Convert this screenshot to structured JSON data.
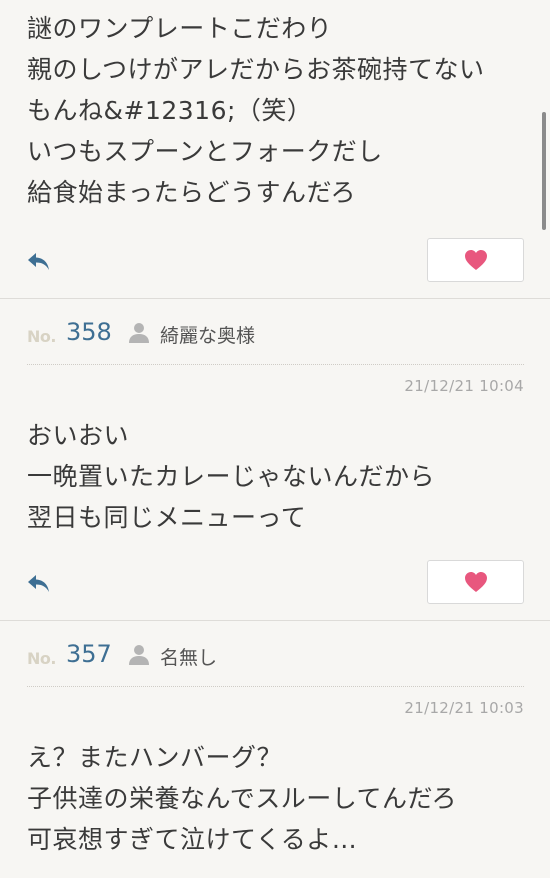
{
  "posts": [
    {
      "lines": [
        "謎のワンプレートこだわり",
        "親のしつけがアレだからお茶碗持てない",
        "もんね&#12316;（笑）",
        "いつもスプーンとフォークだし",
        "給食始まったらどうすんだろ"
      ]
    },
    {
      "no_label": "No.",
      "number": "358",
      "user": "綺麗な奥様",
      "timestamp": "21/12/21 10:04",
      "lines": [
        "おいおい",
        "一晩置いたカレーじゃないんだから",
        "翌日も同じメニューって"
      ]
    },
    {
      "no_label": "No.",
      "number": "357",
      "user": "名無し",
      "timestamp": "21/12/21 10:03",
      "lines": [
        "え？またハンバーグ？",
        "子供達の栄養なんでスルーしてんだろ",
        "可哀想すぎて泣けてくるよ…"
      ]
    }
  ],
  "icons": {
    "reply": "reply-arrow-icon",
    "like": "heart-icon",
    "user": "user-silhouette-icon"
  },
  "colors": {
    "accent_number": "#3e6f93",
    "heart": "#e8577e",
    "reply": "#3e6f93"
  }
}
